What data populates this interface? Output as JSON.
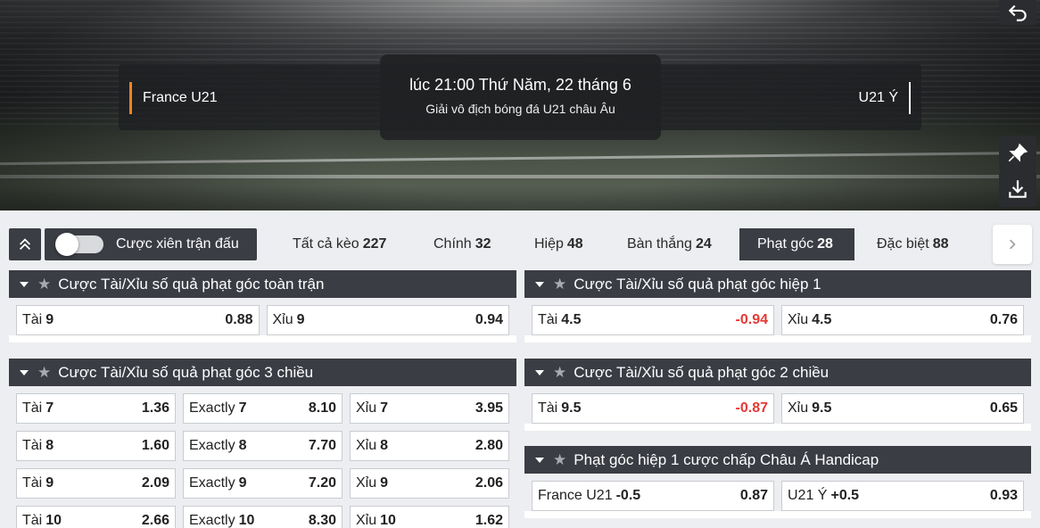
{
  "match": {
    "home_team": "France U21",
    "away_team": "U21 Ý",
    "datetime": "lúc 21:00 Thứ Năm, 22 tháng 6",
    "league": "Giải vô địch bóng đá U21 châu Âu"
  },
  "filter": {
    "toggle_label": "Cược xiên trận đấu",
    "tabs": [
      {
        "label": "Tất cả kèo",
        "count": "227"
      },
      {
        "label": "Chính",
        "count": "32"
      },
      {
        "label": "Hiệp",
        "count": "48"
      },
      {
        "label": "Bàn thắng",
        "count": "24"
      },
      {
        "label": "Phạt góc",
        "count": "28"
      },
      {
        "label": "Đặc biệt",
        "count": "88"
      }
    ],
    "active_tab": "Phạt góc"
  },
  "markets": {
    "m1": {
      "title": "Cược Tài/Xỉu số quả phạt góc toàn trận",
      "rows": [
        [
          {
            "label": "Tài",
            "line": "9",
            "odd": "0.88"
          },
          {
            "label": "Xỉu",
            "line": "9",
            "odd": "0.94"
          }
        ]
      ]
    },
    "m2": {
      "title": "Cược Tài/Xỉu số quả phạt góc hiệp 1",
      "rows": [
        [
          {
            "label": "Tài",
            "line": "4.5",
            "odd": "-0.94"
          },
          {
            "label": "Xỉu",
            "line": "4.5",
            "odd": "0.76"
          }
        ]
      ]
    },
    "m3": {
      "title": "Cược Tài/Xỉu số quả phạt góc 3 chiều",
      "rows": [
        [
          {
            "label": "Tài",
            "line": "7",
            "odd": "1.36"
          },
          {
            "label": "Exactly",
            "line": "7",
            "odd": "8.10"
          },
          {
            "label": "Xỉu",
            "line": "7",
            "odd": "3.95"
          }
        ],
        [
          {
            "label": "Tài",
            "line": "8",
            "odd": "1.60"
          },
          {
            "label": "Exactly",
            "line": "8",
            "odd": "7.70"
          },
          {
            "label": "Xỉu",
            "line": "8",
            "odd": "2.80"
          }
        ],
        [
          {
            "label": "Tài",
            "line": "9",
            "odd": "2.09"
          },
          {
            "label": "Exactly",
            "line": "9",
            "odd": "7.20"
          },
          {
            "label": "Xỉu",
            "line": "9",
            "odd": "2.06"
          }
        ],
        [
          {
            "label": "Tài",
            "line": "10",
            "odd": "2.66"
          },
          {
            "label": "Exactly",
            "line": "10",
            "odd": "8.30"
          },
          {
            "label": "Xỉu",
            "line": "10",
            "odd": "1.62"
          }
        ]
      ]
    },
    "m4": {
      "title": "Cược Tài/Xỉu số quả phạt góc 2 chiều",
      "rows": [
        [
          {
            "label": "Tài",
            "line": "9.5",
            "odd": "-0.87"
          },
          {
            "label": "Xỉu",
            "line": "9.5",
            "odd": "0.65"
          }
        ]
      ]
    },
    "m5": {
      "title": "Phạt góc hiệp 1 cược chấp Châu Á Handicap",
      "rows": [
        [
          {
            "label": "France U21",
            "line": "-0.5",
            "odd": "0.87"
          },
          {
            "label": "U21 Ý",
            "line": "+0.5",
            "odd": "0.93"
          }
        ]
      ]
    }
  },
  "colors": {
    "accent_orange": "#f58220",
    "dark_panel": "#3a3d44",
    "negative_odd": "#e53935"
  },
  "icons": [
    "back-icon",
    "pin-icon",
    "download-icon",
    "collapse-up-icon",
    "chevron-right-icon",
    "caret-down-icon",
    "star-icon"
  ]
}
